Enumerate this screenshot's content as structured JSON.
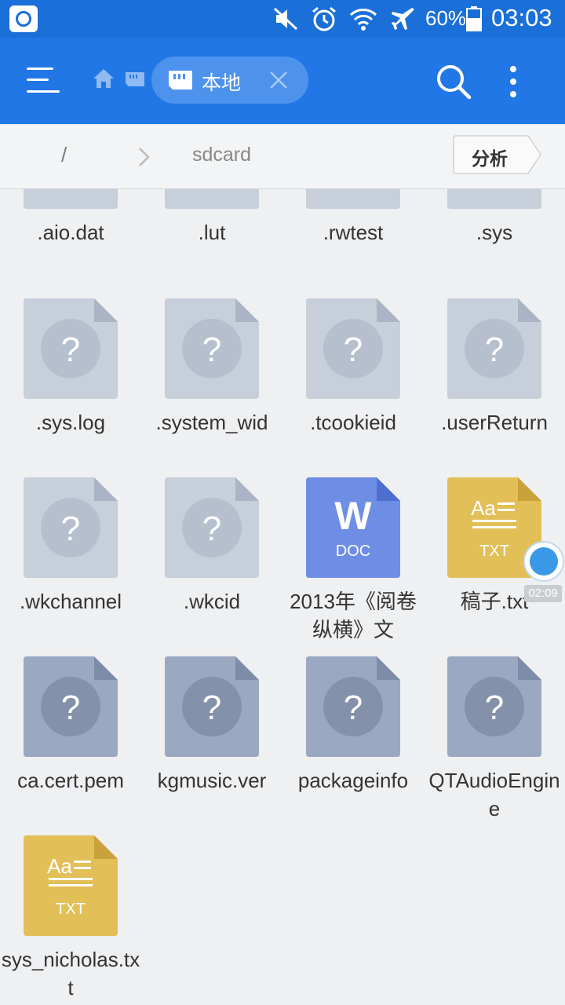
{
  "status_bar": {
    "battery_percent": "60%",
    "time": "03:03",
    "icons": [
      "app-badge-icon",
      "mute-icon",
      "alarm-icon",
      "wifi-icon",
      "airplane-icon",
      "battery-icon"
    ]
  },
  "toolbar": {
    "tab_label": "本地",
    "icons": [
      "menu-icon",
      "home-icon",
      "sdcard-icon",
      "close-icon",
      "search-icon",
      "more-icon"
    ],
    "color": "#2277e6"
  },
  "path_bar": {
    "root": "/",
    "current": "sdcard",
    "analyze_label": "分析"
  },
  "files": [
    {
      "name": ".aio.dat",
      "type": "unknown"
    },
    {
      "name": ".lut",
      "type": "unknown"
    },
    {
      "name": ".rwtest",
      "type": "unknown"
    },
    {
      "name": ".sys",
      "type": "unknown"
    },
    {
      "name": ".sys.log",
      "type": "unknown"
    },
    {
      "name": ".system_wid",
      "type": "unknown"
    },
    {
      "name": ".tcookieid",
      "type": "unknown"
    },
    {
      "name": ".userReturn",
      "type": "unknown"
    },
    {
      "name": ".wkchannel",
      "type": "unknown"
    },
    {
      "name": ".wkcid",
      "type": "unknown"
    },
    {
      "name": "2013年《阅卷纵横》文",
      "type": "doc"
    },
    {
      "name": "稿子.txt",
      "type": "txt"
    },
    {
      "name": "ca.cert.pem",
      "type": "unknown-dark"
    },
    {
      "name": "kgmusic.ver",
      "type": "unknown-dark"
    },
    {
      "name": "packageinfo",
      "type": "unknown-dark"
    },
    {
      "name": "QTAudioEngine",
      "type": "unknown-dark"
    },
    {
      "name": "sys_nicholas.txt",
      "type": "txt"
    }
  ],
  "file_icon_text": {
    "doc_letter": "W",
    "doc_label": "DOC",
    "txt_letters": "Aa",
    "txt_label": "TXT",
    "unknown_mark": "?"
  },
  "floating_widget": {
    "time": "02:09"
  }
}
